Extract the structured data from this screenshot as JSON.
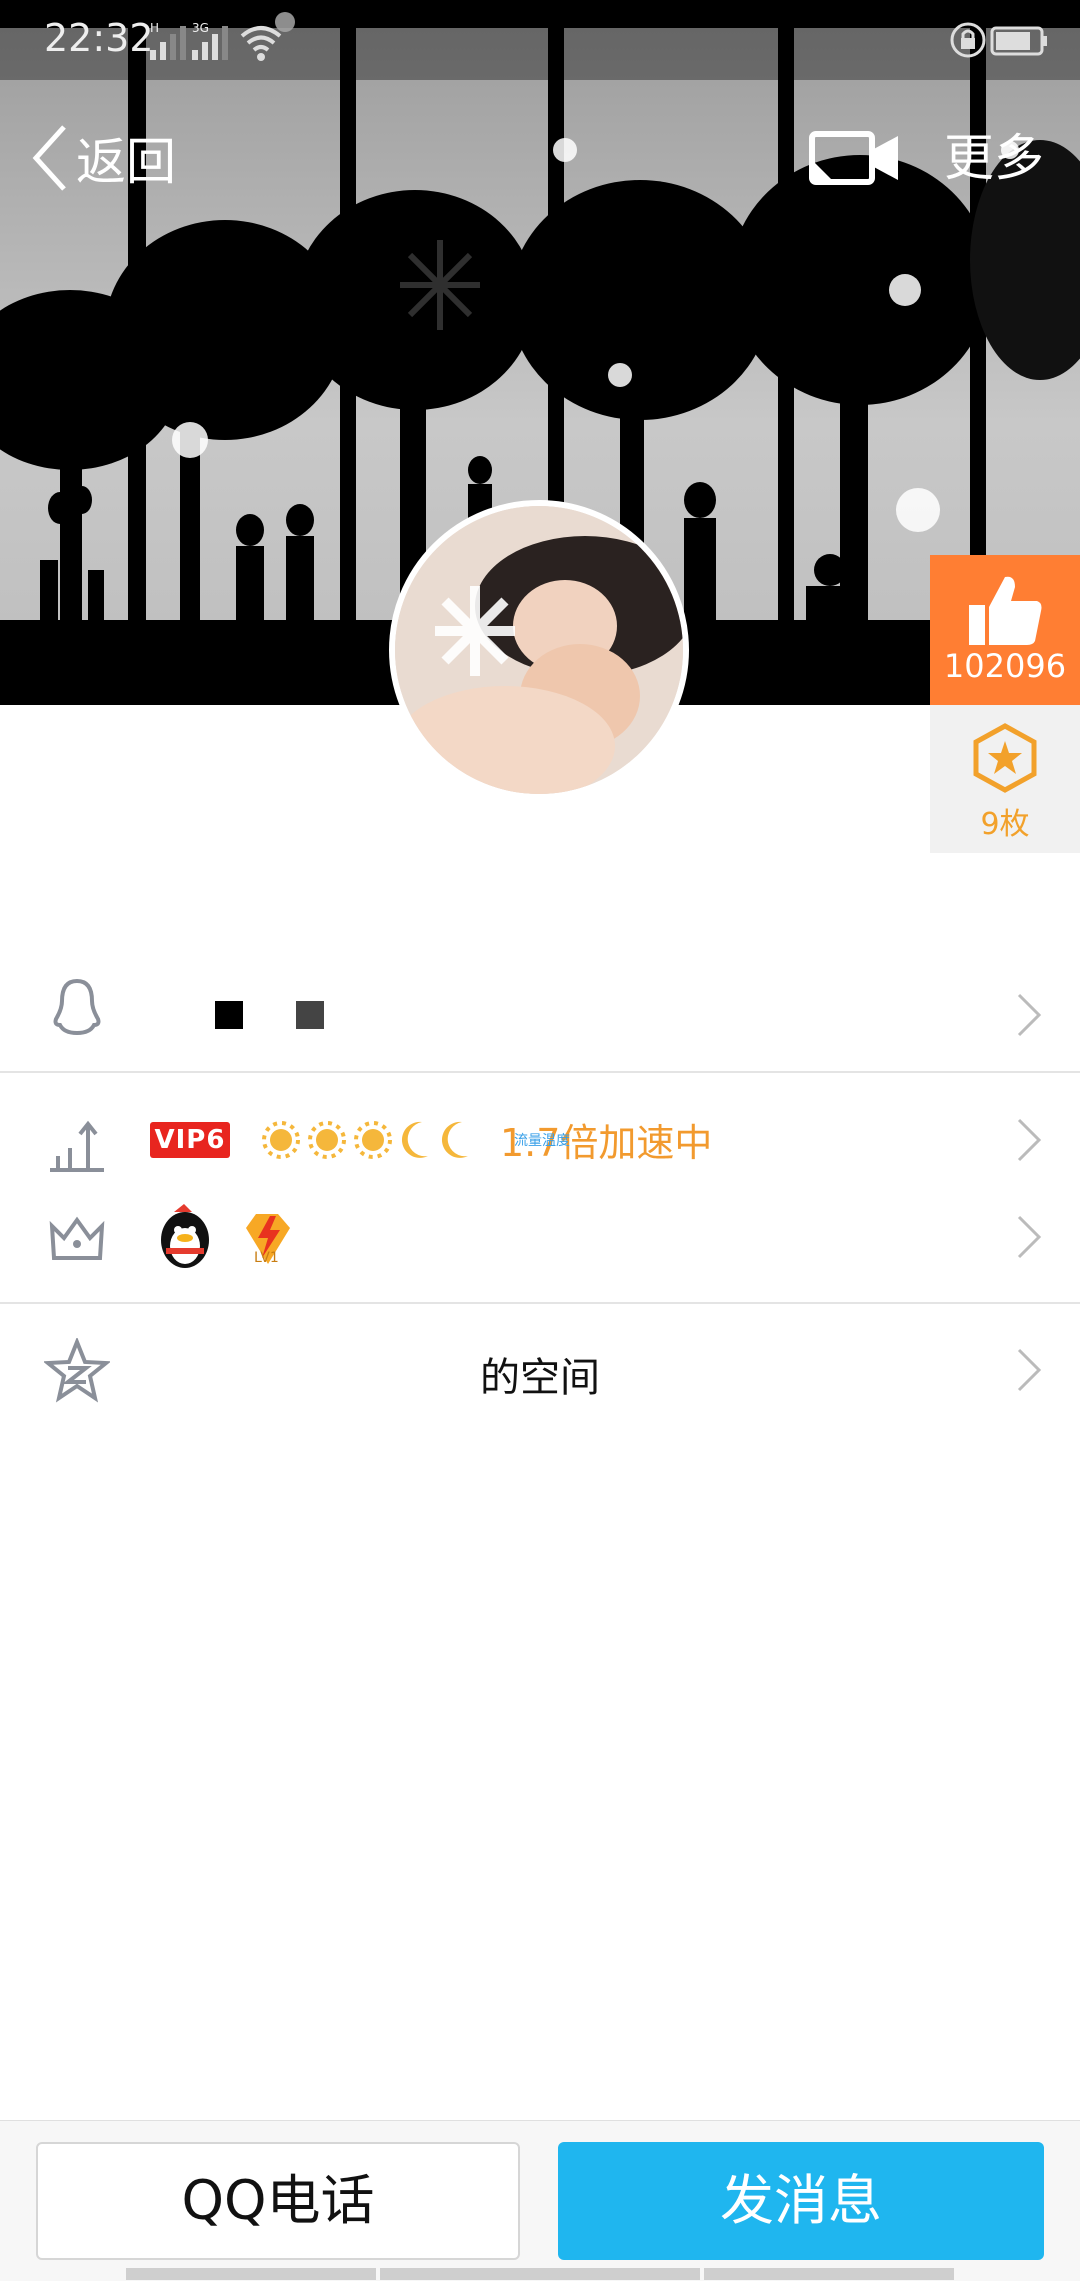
{
  "status_bar": {
    "time": "22:32",
    "sig1_label": "H",
    "sig2_label": "3G"
  },
  "nav": {
    "back_label": "返回",
    "more_label": "更多"
  },
  "side": {
    "like_count": "102096",
    "badge_count": "9枚",
    "like_color": "#ff7e33",
    "badge_color": "#f2a12b"
  },
  "vip": {
    "badge_label": "VIP6",
    "speed_text": "1.7倍加速中",
    "small_overlay": "流量温度",
    "level_icons": [
      "sun-icon",
      "sun-icon",
      "sun-icon",
      "moon-icon",
      "moon-icon"
    ]
  },
  "space": {
    "label": "的空间"
  },
  "bottom": {
    "call_label": "QQ电话",
    "message_label": "发消息",
    "message_color": "#1fb6ef"
  }
}
